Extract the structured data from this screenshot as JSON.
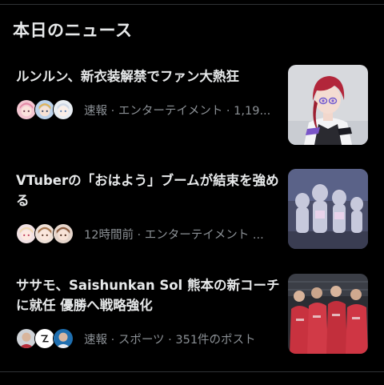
{
  "section": {
    "title": "本日のニュース"
  },
  "news": [
    {
      "headline": "ルンルン、新衣装解禁でファン大熱狂",
      "meta": "速報 · エンターテイメント · 1,19...",
      "avatars": [
        "anime-avatar-pink",
        "anime-avatar-blue",
        "anime-avatar-white"
      ],
      "thumbnail": "vtuber-character-red-hair"
    },
    {
      "headline": "VTuberの「おはよう」ブームが結束を強める",
      "meta": "12時間前 · エンターテイメント ...",
      "avatars": [
        "anime-avatar-pink",
        "anime-avatar-brown",
        "anime-avatar-brown"
      ],
      "thumbnail": "vtuber-group-characters"
    },
    {
      "headline": "ササモ、Saishunkan Sol 熊本の新コーチに就任 優勝へ戦略強化",
      "meta": "速報 · スポーツ · 351件のポスト",
      "avatars": [
        "person-avatar",
        "logo-avatar-white",
        "person-avatar-blue"
      ],
      "thumbnail": "sports-team-red-jerseys"
    }
  ],
  "colors": {
    "background": "#000000",
    "primary_text": "#e7e9ea",
    "secondary_text": "#8b9095",
    "divider": "#2f3336"
  }
}
